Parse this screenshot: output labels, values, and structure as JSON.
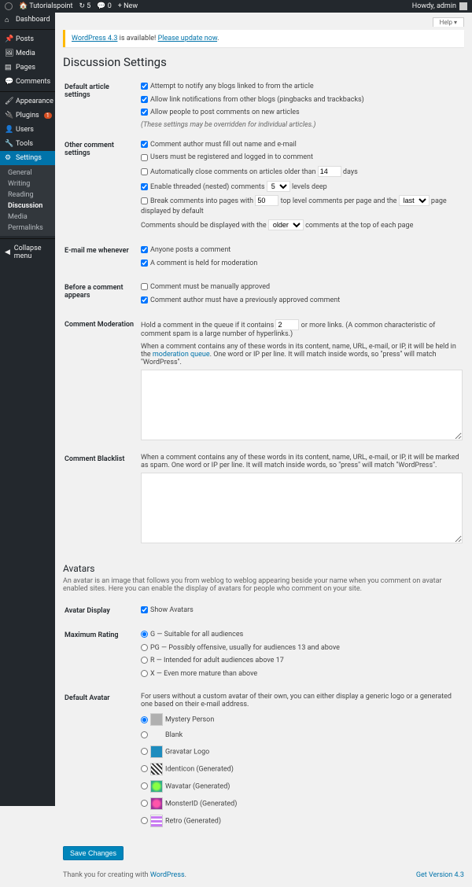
{
  "adminbar": {
    "site": "Tutorialspoint",
    "comments": "5",
    "updates": "0",
    "new": "New",
    "howdy": "Howdy, admin"
  },
  "help": "Help",
  "sidebar": {
    "dashboard": "Dashboard",
    "posts": "Posts",
    "media": "Media",
    "pages": "Pages",
    "comments": "Comments",
    "appearance": "Appearance",
    "plugins": "Plugins",
    "plugins_badge": "1",
    "users": "Users",
    "tools": "Tools",
    "settings": "Settings",
    "sub": {
      "general": "General",
      "writing": "Writing",
      "reading": "Reading",
      "discussion": "Discussion",
      "media": "Media",
      "permalinks": "Permalinks"
    },
    "collapse": "Collapse menu"
  },
  "notice": {
    "a": "WordPress 4.3",
    "b": " is available! ",
    "c": "Please update now",
    "d": "."
  },
  "title": "Discussion Settings",
  "sections": {
    "default": {
      "th": "Default article settings",
      "c1": "Attempt to notify any blogs linked to from the article",
      "c2": "Allow link notifications from other blogs (pingbacks and trackbacks)",
      "c3": "Allow people to post comments on new articles",
      "note": "(These settings may be overridden for individual articles.)"
    },
    "other": {
      "th": "Other comment settings",
      "c1": "Comment author must fill out name and e-mail",
      "c2": "Users must be registered and logged in to comment",
      "c3a": "Automatically close comments on articles older than ",
      "c3b": " days",
      "c3v": "14",
      "c4a": "Enable threaded (nested) comments ",
      "c4b": " levels deep",
      "c4v": "5",
      "c5a": "Break comments into pages with ",
      "c5b": " top level comments per page and the ",
      "c5c": " page displayed by default",
      "c5v": "50",
      "c5s": "last",
      "c6a": "Comments should be displayed with the ",
      "c6b": " comments at the top of each page",
      "c6s": "older"
    },
    "email": {
      "th": "E-mail me whenever",
      "c1": "Anyone posts a comment",
      "c2": "A comment is held for moderation"
    },
    "before": {
      "th": "Before a comment appears",
      "c1": "Comment must be manually approved",
      "c2": "Comment author must have a previously approved comment"
    },
    "mod": {
      "th": "Comment Moderation",
      "p1a": "Hold a comment in the queue if it contains ",
      "p1v": "2",
      "p1b": " or more links. (A common characteristic of comment spam is a large number of hyperlinks.)",
      "p2a": "When a comment contains any of these words in its content, name, URL, e-mail, or IP, it will be held in the ",
      "p2l": "moderation queue",
      "p2b": ". One word or IP per line. It will match inside words, so \"press\" will match \"WordPress\"."
    },
    "black": {
      "th": "Comment Blacklist",
      "p": "When a comment contains any of these words in its content, name, URL, e-mail, or IP, it will be marked as spam. One word or IP per line. It will match inside words, so \"press\" will match \"WordPress\"."
    }
  },
  "avatars": {
    "h": "Avatars",
    "desc": "An avatar is an image that follows you from weblog to weblog appearing beside your name when you comment on avatar enabled sites. Here you can enable the display of avatars for people who comment on your site.",
    "display": {
      "th": "Avatar Display",
      "c": "Show Avatars"
    },
    "rating": {
      "th": "Maximum Rating",
      "g": "G — Suitable for all audiences",
      "pg": "PG — Possibly offensive, usually for audiences 13 and above",
      "r": "R — Intended for adult audiences above 17",
      "x": "X — Even more mature than above"
    },
    "default": {
      "th": "Default Avatar",
      "desc": "For users without a custom avatar of their own, you can either display a generic logo or a generated one based on their e-mail address.",
      "mystery": "Mystery Person",
      "blank": "Blank",
      "gravatar": "Gravatar Logo",
      "identicon": "Identicon (Generated)",
      "wavatar": "Wavatar (Generated)",
      "monster": "MonsterID (Generated)",
      "retro": "Retro (Generated)"
    }
  },
  "save": "Save Changes",
  "footer": {
    "thanks": "Thank you for creating with ",
    "wp": "WordPress",
    "ver": "Get Version 4.3"
  }
}
